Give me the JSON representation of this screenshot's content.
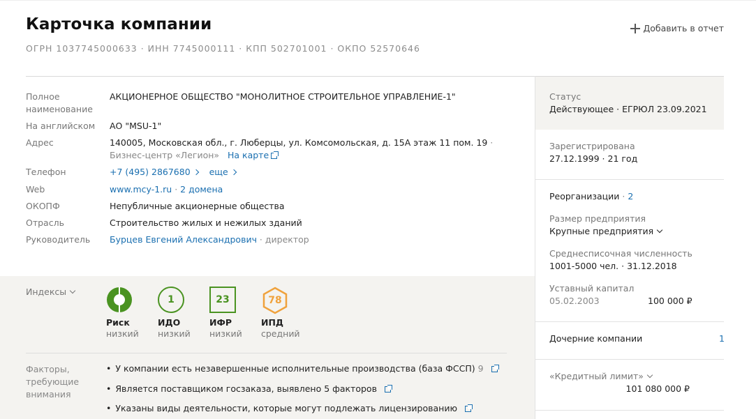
{
  "header": {
    "title": "Карточка компании",
    "ids": "ОГРН 1037745000633 · ИНН 7745000111 · КПП 502701001 · ОКПО 52570646",
    "add_report": "Добавить в отчет"
  },
  "info": {
    "full_name_label": "Полное наименование",
    "full_name": "АКЦИОНЕРНОЕ ОБЩЕСТВО \"МОНОЛИТНОЕ СТРОИТЕЛЬНОЕ УПРАВЛЕНИЕ-1\"",
    "english_label": "На английском",
    "english": "АО \"MSU-1\"",
    "address_label": "Адрес",
    "address": "140005, Московская обл., г. Люберцы, ул. Комсомольская, д. 15А этаж 11 пом. 19",
    "address_extra": " · Бизнес-центр «Легион»",
    "map_link": "На карте",
    "phone_label": "Телефон",
    "phone": "+7 (495) 2867680",
    "phone_more": "еще",
    "web_label": "Web",
    "web": "www.mcy-1.ru",
    "web_domains": "2 домена",
    "okopf_label": "ОКОПФ",
    "okopf": "Непубличные акционерные общества",
    "industry_label": "Отрасль",
    "industry": "Строительство жилых и нежилых зданий",
    "head_label": "Руководитель",
    "head_name": "Бурцев Евгений Александрович",
    "head_role": " · директор"
  },
  "indices": {
    "label": "Индексы",
    "items": [
      {
        "name": "Риск",
        "level": "низкий"
      },
      {
        "name": "ИДО",
        "value": "1",
        "level": "низкий"
      },
      {
        "name": "ИФР",
        "value": "23",
        "level": "низкий"
      },
      {
        "name": "ИПД",
        "value": "78",
        "level": "средний"
      }
    ]
  },
  "factors": {
    "label": "Факторы, требующие внимания",
    "items": [
      {
        "text": "У компании есть незавершенные исполнительные производства (база ФССП)",
        "count": "9"
      },
      {
        "text": "Является поставщиком госзаказа, выявлено 5 факторов"
      },
      {
        "text": "Указаны виды деятельности, которые могут подлежать лицензированию"
      }
    ]
  },
  "right": {
    "status_label": "Статус",
    "status_value": "Действующее · ЕГРЮЛ 23.09.2021",
    "registered_label": "Зарегистрирована",
    "registered_value": "27.12.1999 · 21 год",
    "reorg_label": "Реорганизации",
    "reorg_count": "2",
    "size_label": "Размер предприятия",
    "size_value": "Крупные предприятия",
    "staff_label": "Среднесписочная численность",
    "staff_value": "1001-5000 чел. · 31.12.2018",
    "capital_label": "Уставный капитал",
    "capital_date": "05.02.2003",
    "capital_value": "100 000 ₽",
    "subsidiaries_label": "Дочерние компании",
    "subsidiaries_count": "1",
    "credit_label": "«Кредитный лимит»",
    "credit_value": "101 080 000 ₽"
  },
  "colors": {
    "green": "#4a9321",
    "orange": "#f0a23c",
    "link": "#1a6fb0",
    "panel": "#f4f3f0"
  }
}
